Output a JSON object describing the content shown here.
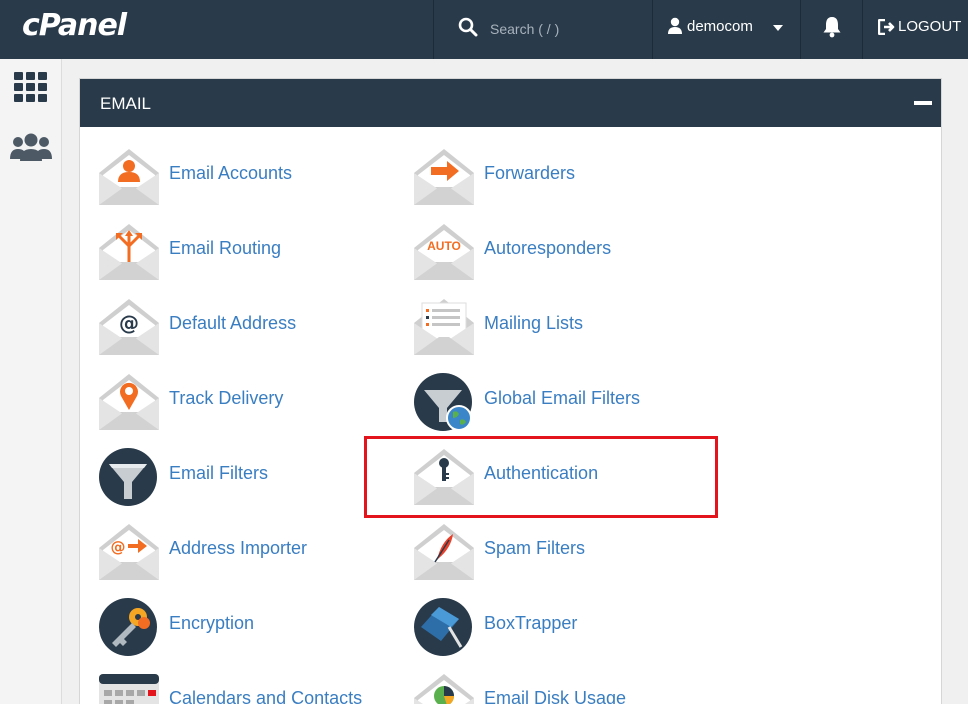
{
  "topbar": {
    "logo": "cPanel",
    "search_placeholder": "Search ( / )",
    "username": "democom",
    "logout_label": "LOGOUT"
  },
  "sidebar": {
    "items": [
      {
        "icon": "apps-grid-icon"
      },
      {
        "icon": "users-icon"
      }
    ]
  },
  "panel": {
    "title": "EMAIL",
    "items": [
      {
        "label": "Email Accounts",
        "icon": "envelope-user-icon"
      },
      {
        "label": "Forwarders",
        "icon": "envelope-arrow-icon"
      },
      {
        "label": "Email Routing",
        "icon": "envelope-routing-icon"
      },
      {
        "label": "Autoresponders",
        "icon": "envelope-auto-icon",
        "icon_text": "AUTO"
      },
      {
        "label": "Default Address",
        "icon": "envelope-at-icon",
        "icon_text": "@"
      },
      {
        "label": "Mailing Lists",
        "icon": "envelope-list-icon"
      },
      {
        "label": "Track Delivery",
        "icon": "envelope-pin-icon"
      },
      {
        "label": "Global Email Filters",
        "icon": "funnel-globe-icon"
      },
      {
        "label": "Email Filters",
        "icon": "funnel-icon"
      },
      {
        "label": "Authentication",
        "icon": "envelope-key-icon"
      },
      {
        "label": "Address Importer",
        "icon": "envelope-import-icon",
        "icon_text": "@"
      },
      {
        "label": "Spam Filters",
        "icon": "envelope-feather-icon"
      },
      {
        "label": "Encryption",
        "icon": "keys-icon"
      },
      {
        "label": "BoxTrapper",
        "icon": "box-trap-icon"
      },
      {
        "label": "Calendars and Contacts",
        "icon": "calendar-icon"
      },
      {
        "label": "Email Disk Usage",
        "icon": "envelope-pie-icon"
      }
    ]
  },
  "colors": {
    "topbar": "#293a4a",
    "link": "#3a7ec2",
    "accent_orange": "#f26d21",
    "highlight": "#e3141b"
  }
}
